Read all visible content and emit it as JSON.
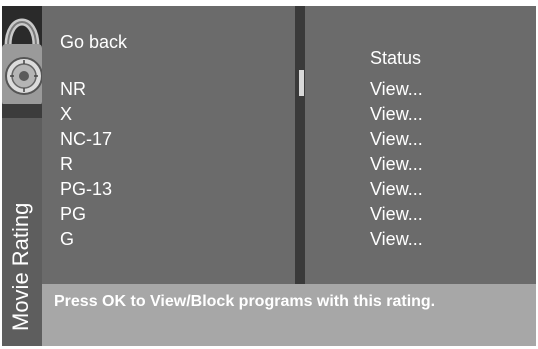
{
  "sidebar": {
    "title": "Movie Rating"
  },
  "menu": {
    "go_back_label": "Go back",
    "status_header": "Status",
    "ratings": [
      {
        "label": "NR",
        "status": "View..."
      },
      {
        "label": "X",
        "status": "View..."
      },
      {
        "label": "NC-17",
        "status": "View..."
      },
      {
        "label": "R",
        "status": "View..."
      },
      {
        "label": "PG-13",
        "status": "View..."
      },
      {
        "label": "PG",
        "status": "View..."
      },
      {
        "label": "G",
        "status": "View..."
      }
    ]
  },
  "footer": {
    "hint": "Press OK to View/Block programs with this rating."
  },
  "colors": {
    "panel": "#6b6b6b",
    "footer": "#a7a7a7",
    "sidebar": "#5e5e5e",
    "text": "#ffffff"
  },
  "icons": {
    "sidebar_graphic": "lock-icon"
  }
}
